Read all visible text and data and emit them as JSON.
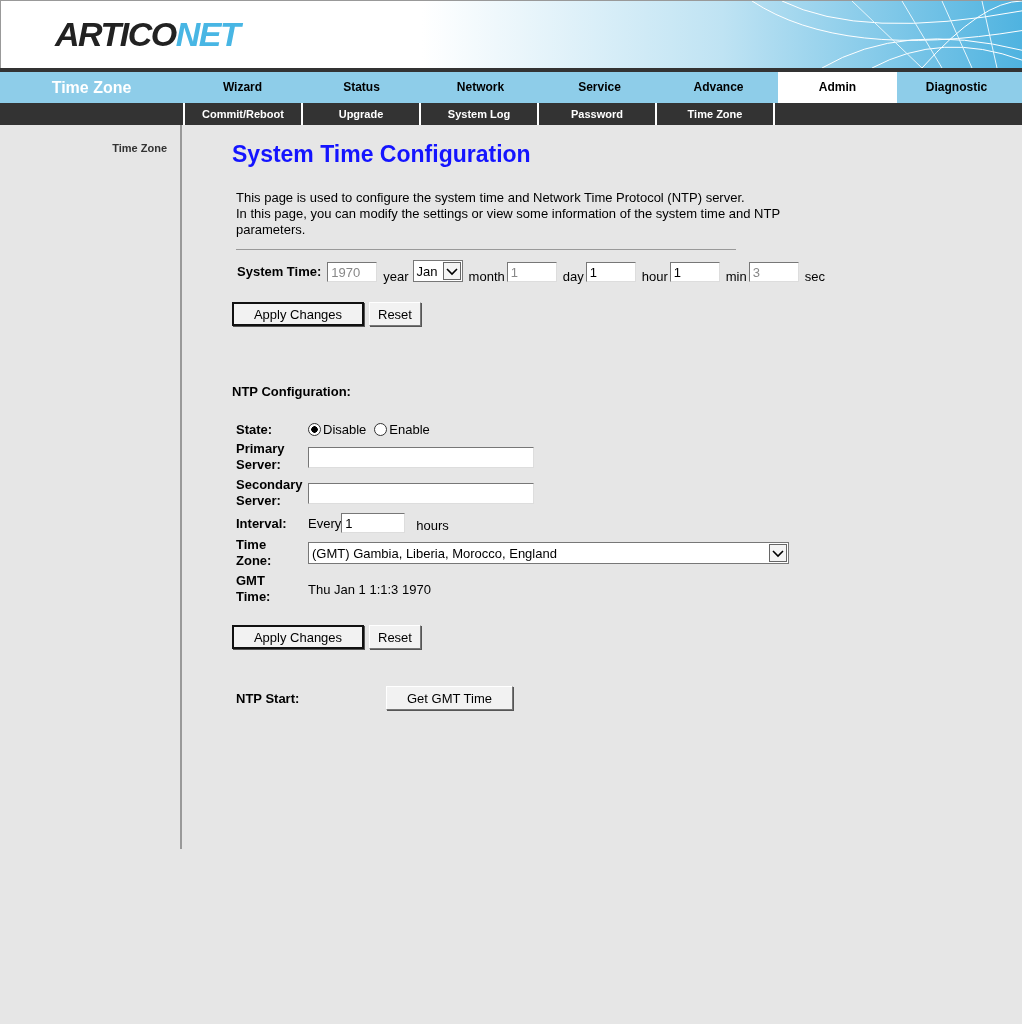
{
  "logo": {
    "text": "ARTICO",
    "accent": "NET"
  },
  "section_title": "Time Zone",
  "tabs": [
    {
      "label": "Wizard",
      "selected": false
    },
    {
      "label": "Status",
      "selected": false
    },
    {
      "label": "Network",
      "selected": false
    },
    {
      "label": "Service",
      "selected": false
    },
    {
      "label": "Advance",
      "selected": false
    },
    {
      "label": "Admin",
      "selected": true
    },
    {
      "label": "Diagnostic",
      "selected": false
    }
  ],
  "subtabs": [
    {
      "label": "Commit/Reboot"
    },
    {
      "label": "Upgrade"
    },
    {
      "label": "System Log"
    },
    {
      "label": "Password"
    },
    {
      "label": "Time Zone"
    }
  ],
  "sidebar": {
    "items": [
      {
        "label": "Time Zone"
      }
    ]
  },
  "title": "System Time Configuration",
  "description": [
    "This page is used to configure the system time and Network Time Protocol (NTP) server.",
    "In this page, you can modify the settings or view some information of the system time and NTP parameters."
  ],
  "system_time": {
    "label": "System Time:",
    "fields": [
      {
        "value": "1970",
        "unit": "year",
        "kind": "input",
        "disabled": true
      },
      {
        "value": "Jan",
        "unit": "month",
        "kind": "select",
        "disabled": false
      },
      {
        "value": "1",
        "unit": "day",
        "kind": "input",
        "disabled": true
      },
      {
        "value": "1",
        "unit": "hour",
        "kind": "input",
        "disabled": false
      },
      {
        "value": "1",
        "unit": "min",
        "kind": "input",
        "disabled": false
      },
      {
        "value": "3",
        "unit": "sec",
        "kind": "input",
        "disabled": true
      }
    ]
  },
  "buttons_1": [
    "Apply Changes",
    "Reset"
  ],
  "ntp": {
    "heading": "NTP Configuration:",
    "state": {
      "label": "State:",
      "options": [
        {
          "label": "Disable",
          "selected": true
        },
        {
          "label": "Enable",
          "selected": false
        }
      ]
    },
    "primary": {
      "label": [
        "Primary",
        "Server:"
      ]
    },
    "secondary": {
      "label": [
        "Secondary",
        "Server:"
      ]
    },
    "interval": {
      "label": "Interval:",
      "prefix": "Every",
      "value": "1",
      "suffix": "hours"
    },
    "time_zone": {
      "label": [
        "Time",
        "Zone:"
      ],
      "value": "(GMT) Gambia, Liberia, Morocco, England"
    },
    "gmt_time": {
      "label": [
        "GMT",
        "Time:"
      ],
      "value": "Thu Jan 1 1:1:3 1970"
    }
  },
  "buttons_2": [
    "Apply Changes",
    "Reset"
  ],
  "ntp_start": {
    "label": "NTP Start:",
    "button": "Get GMT Time"
  }
}
